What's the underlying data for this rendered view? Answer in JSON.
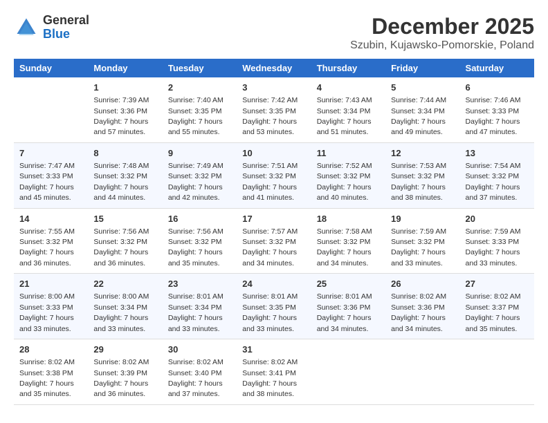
{
  "logo": {
    "general": "General",
    "blue": "Blue"
  },
  "title": "December 2025",
  "location": "Szubin, Kujawsko-Pomorskie, Poland",
  "weekdays": [
    "Sunday",
    "Monday",
    "Tuesday",
    "Wednesday",
    "Thursday",
    "Friday",
    "Saturday"
  ],
  "weeks": [
    [
      {
        "day": "",
        "sunrise": "",
        "sunset": "",
        "daylight": ""
      },
      {
        "day": "1",
        "sunrise": "Sunrise: 7:39 AM",
        "sunset": "Sunset: 3:36 PM",
        "daylight": "Daylight: 7 hours and 57 minutes."
      },
      {
        "day": "2",
        "sunrise": "Sunrise: 7:40 AM",
        "sunset": "Sunset: 3:35 PM",
        "daylight": "Daylight: 7 hours and 55 minutes."
      },
      {
        "day": "3",
        "sunrise": "Sunrise: 7:42 AM",
        "sunset": "Sunset: 3:35 PM",
        "daylight": "Daylight: 7 hours and 53 minutes."
      },
      {
        "day": "4",
        "sunrise": "Sunrise: 7:43 AM",
        "sunset": "Sunset: 3:34 PM",
        "daylight": "Daylight: 7 hours and 51 minutes."
      },
      {
        "day": "5",
        "sunrise": "Sunrise: 7:44 AM",
        "sunset": "Sunset: 3:34 PM",
        "daylight": "Daylight: 7 hours and 49 minutes."
      },
      {
        "day": "6",
        "sunrise": "Sunrise: 7:46 AM",
        "sunset": "Sunset: 3:33 PM",
        "daylight": "Daylight: 7 hours and 47 minutes."
      }
    ],
    [
      {
        "day": "7",
        "sunrise": "Sunrise: 7:47 AM",
        "sunset": "Sunset: 3:33 PM",
        "daylight": "Daylight: 7 hours and 45 minutes."
      },
      {
        "day": "8",
        "sunrise": "Sunrise: 7:48 AM",
        "sunset": "Sunset: 3:32 PM",
        "daylight": "Daylight: 7 hours and 44 minutes."
      },
      {
        "day": "9",
        "sunrise": "Sunrise: 7:49 AM",
        "sunset": "Sunset: 3:32 PM",
        "daylight": "Daylight: 7 hours and 42 minutes."
      },
      {
        "day": "10",
        "sunrise": "Sunrise: 7:51 AM",
        "sunset": "Sunset: 3:32 PM",
        "daylight": "Daylight: 7 hours and 41 minutes."
      },
      {
        "day": "11",
        "sunrise": "Sunrise: 7:52 AM",
        "sunset": "Sunset: 3:32 PM",
        "daylight": "Daylight: 7 hours and 40 minutes."
      },
      {
        "day": "12",
        "sunrise": "Sunrise: 7:53 AM",
        "sunset": "Sunset: 3:32 PM",
        "daylight": "Daylight: 7 hours and 38 minutes."
      },
      {
        "day": "13",
        "sunrise": "Sunrise: 7:54 AM",
        "sunset": "Sunset: 3:32 PM",
        "daylight": "Daylight: 7 hours and 37 minutes."
      }
    ],
    [
      {
        "day": "14",
        "sunrise": "Sunrise: 7:55 AM",
        "sunset": "Sunset: 3:32 PM",
        "daylight": "Daylight: 7 hours and 36 minutes."
      },
      {
        "day": "15",
        "sunrise": "Sunrise: 7:56 AM",
        "sunset": "Sunset: 3:32 PM",
        "daylight": "Daylight: 7 hours and 36 minutes."
      },
      {
        "day": "16",
        "sunrise": "Sunrise: 7:56 AM",
        "sunset": "Sunset: 3:32 PM",
        "daylight": "Daylight: 7 hours and 35 minutes."
      },
      {
        "day": "17",
        "sunrise": "Sunrise: 7:57 AM",
        "sunset": "Sunset: 3:32 PM",
        "daylight": "Daylight: 7 hours and 34 minutes."
      },
      {
        "day": "18",
        "sunrise": "Sunrise: 7:58 AM",
        "sunset": "Sunset: 3:32 PM",
        "daylight": "Daylight: 7 hours and 34 minutes."
      },
      {
        "day": "19",
        "sunrise": "Sunrise: 7:59 AM",
        "sunset": "Sunset: 3:32 PM",
        "daylight": "Daylight: 7 hours and 33 minutes."
      },
      {
        "day": "20",
        "sunrise": "Sunrise: 7:59 AM",
        "sunset": "Sunset: 3:33 PM",
        "daylight": "Daylight: 7 hours and 33 minutes."
      }
    ],
    [
      {
        "day": "21",
        "sunrise": "Sunrise: 8:00 AM",
        "sunset": "Sunset: 3:33 PM",
        "daylight": "Daylight: 7 hours and 33 minutes."
      },
      {
        "day": "22",
        "sunrise": "Sunrise: 8:00 AM",
        "sunset": "Sunset: 3:34 PM",
        "daylight": "Daylight: 7 hours and 33 minutes."
      },
      {
        "day": "23",
        "sunrise": "Sunrise: 8:01 AM",
        "sunset": "Sunset: 3:34 PM",
        "daylight": "Daylight: 7 hours and 33 minutes."
      },
      {
        "day": "24",
        "sunrise": "Sunrise: 8:01 AM",
        "sunset": "Sunset: 3:35 PM",
        "daylight": "Daylight: 7 hours and 33 minutes."
      },
      {
        "day": "25",
        "sunrise": "Sunrise: 8:01 AM",
        "sunset": "Sunset: 3:36 PM",
        "daylight": "Daylight: 7 hours and 34 minutes."
      },
      {
        "day": "26",
        "sunrise": "Sunrise: 8:02 AM",
        "sunset": "Sunset: 3:36 PM",
        "daylight": "Daylight: 7 hours and 34 minutes."
      },
      {
        "day": "27",
        "sunrise": "Sunrise: 8:02 AM",
        "sunset": "Sunset: 3:37 PM",
        "daylight": "Daylight: 7 hours and 35 minutes."
      }
    ],
    [
      {
        "day": "28",
        "sunrise": "Sunrise: 8:02 AM",
        "sunset": "Sunset: 3:38 PM",
        "daylight": "Daylight: 7 hours and 35 minutes."
      },
      {
        "day": "29",
        "sunrise": "Sunrise: 8:02 AM",
        "sunset": "Sunset: 3:39 PM",
        "daylight": "Daylight: 7 hours and 36 minutes."
      },
      {
        "day": "30",
        "sunrise": "Sunrise: 8:02 AM",
        "sunset": "Sunset: 3:40 PM",
        "daylight": "Daylight: 7 hours and 37 minutes."
      },
      {
        "day": "31",
        "sunrise": "Sunrise: 8:02 AM",
        "sunset": "Sunset: 3:41 PM",
        "daylight": "Daylight: 7 hours and 38 minutes."
      },
      {
        "day": "",
        "sunrise": "",
        "sunset": "",
        "daylight": ""
      },
      {
        "day": "",
        "sunrise": "",
        "sunset": "",
        "daylight": ""
      },
      {
        "day": "",
        "sunrise": "",
        "sunset": "",
        "daylight": ""
      }
    ]
  ]
}
